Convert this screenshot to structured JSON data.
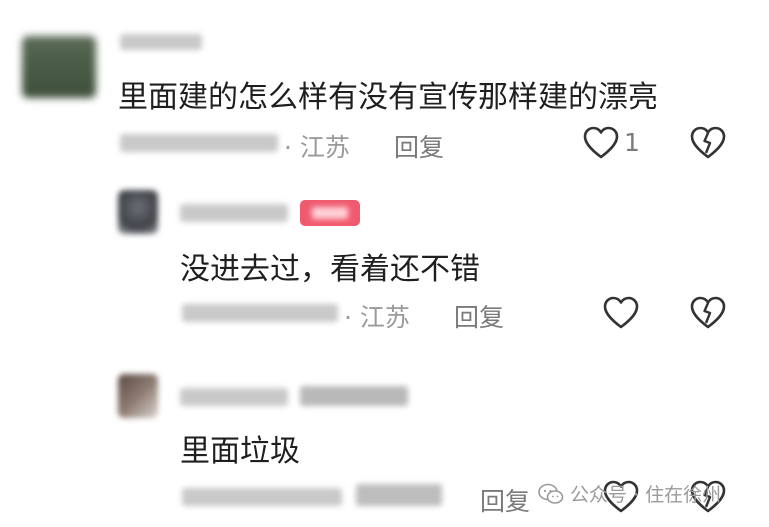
{
  "comments": [
    {
      "text": "里面建的怎么样有没有宣传那样建的漂亮",
      "location": "· 江苏",
      "reply_label": "回复",
      "like_count": "1"
    },
    {
      "text": "没进去过，看着还不错",
      "location": "· 江苏",
      "reply_label": "回复",
      "like_count": ""
    },
    {
      "text": "里面垃圾",
      "location": "",
      "reply_label": "回复",
      "like_count": ""
    }
  ],
  "watermark": {
    "text": "公众号 · 住在徐州",
    "icon": "wechat-icon"
  },
  "colors": {
    "badge": "#f05a6e",
    "text": "#1f1f1f",
    "meta": "#9a9a9a"
  }
}
